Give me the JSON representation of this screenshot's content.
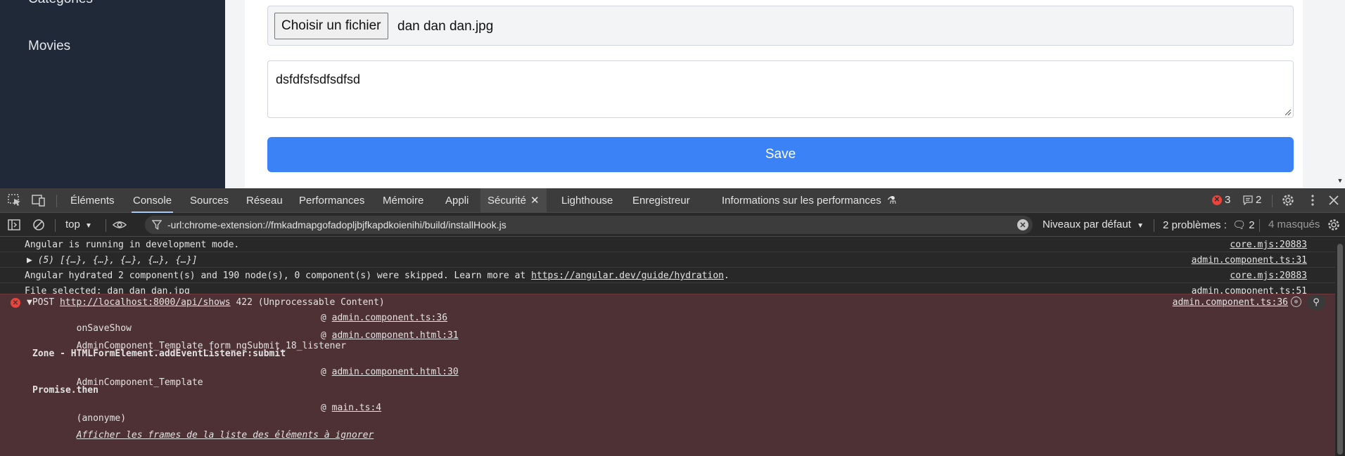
{
  "sidebar": {
    "items": [
      {
        "label": "Catégories"
      },
      {
        "label": "Movies"
      }
    ]
  },
  "form": {
    "file_button_label": "Choisir un fichier",
    "file_name": "dan dan dan.jpg",
    "textarea_value": "dsfdfsfsdfsdfsd",
    "save_label": "Save"
  },
  "devtools": {
    "tabs": [
      "Éléments",
      "Console",
      "Sources",
      "Réseau",
      "Performances",
      "Mémoire",
      "Appli",
      "Sécurité",
      "Lighthouse",
      "Enregistreur",
      "Informations sur les performances"
    ],
    "active_tab": "Console",
    "error_count": "3",
    "message_count": "2",
    "context": "top",
    "filter_text": "-url:chrome-extension://fmkadmapgofadopljbjfkapdkoienihi/build/installHook.js",
    "levels_label": "Niveaux par défaut",
    "problems_label": "2 problèmes :",
    "problems_count": "2",
    "masked_label": "4 masqués",
    "console_lines": [
      {
        "text": "Angular is running in development mode.",
        "source": "core.mjs:20883"
      },
      {
        "text": "▶ (5) [{…}, {…}, {…}, {…}, {…}]",
        "source": "admin.component.ts:31"
      },
      {
        "text_before": "Angular hydrated 2 component(s) and 190 node(s), 0 component(s) were skipped. Learn more at ",
        "link": "https://angular.dev/guide/hydration",
        "text_after": ".",
        "source": "core.mjs:20883"
      },
      {
        "text": "File selected: dan dan dan.jpg",
        "source": "admin.component.ts:51"
      }
    ],
    "error": {
      "method": "▼POST",
      "url": "http://localhost:8000/api/shows",
      "status": "422 (Unprocessable Content)",
      "source": "admin.component.ts:36",
      "stack": [
        {
          "fn": "onSaveShow",
          "at": "@",
          "loc": "admin.component.ts:36",
          "bold": false
        },
        {
          "fn": "AdminComponent_Template_form_ngSubmit_18_listener",
          "at": "@",
          "loc": "admin.component.html:31",
          "bold": false
        },
        {
          "fn": "Zone - HTMLFormElement.addEventListener:submit",
          "at": "",
          "loc": "",
          "bold": true
        },
        {
          "fn": "AdminComponent_Template",
          "at": "@",
          "loc": "admin.component.html:30",
          "bold": false
        },
        {
          "fn": "Promise.then",
          "at": "",
          "loc": "",
          "bold": true
        },
        {
          "fn": "(anonyme)",
          "at": "@",
          "loc": "main.ts:4",
          "bold": false
        }
      ],
      "ignore_link": "Afficher les frames de la liste des éléments à ignorer"
    }
  }
}
